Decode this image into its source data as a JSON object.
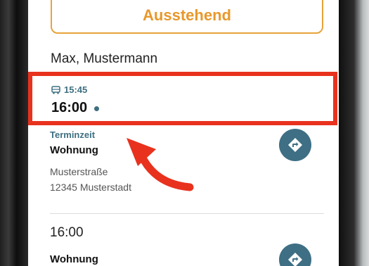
{
  "appointment": {
    "status_label": "Ausstehend",
    "patient_name": "Max, Mustermann",
    "pickup_time": "15:45",
    "appointment_time": "16:00",
    "time_label": "Terminzeit",
    "place": "Wohnung",
    "street": "Musterstraße",
    "city": "12345 Musterstadt"
  },
  "next_appointment": {
    "time": "16:00",
    "place": "Wohnung"
  },
  "icons": {
    "pickup": "bus-icon",
    "navigate": "directions-icon",
    "status_dot": "dot-indicator"
  },
  "colors": {
    "status_orange": "#e8982b",
    "accent_teal": "#3e6f84",
    "highlight_red": "#e8321e"
  }
}
